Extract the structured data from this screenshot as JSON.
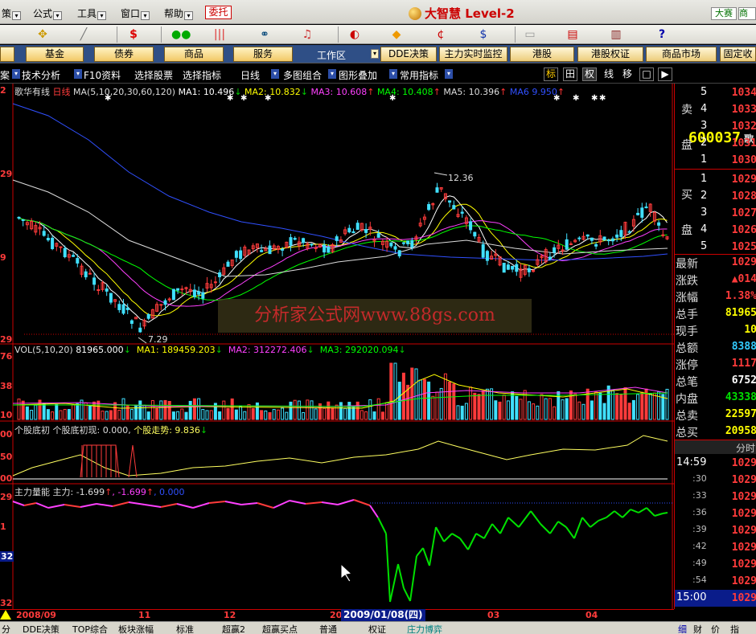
{
  "menu": [
    "策",
    "公式",
    "工具",
    "窗口",
    "帮助"
  ],
  "trust_button": "委托",
  "app_title": "大智慧 Level-2",
  "top_right_buttons": [
    "大赛",
    "商"
  ],
  "toolbar_icons": [
    "pointer-icon",
    "ruler-icon",
    "s-logo-icon",
    "traffic-icon",
    "bars-icon",
    "binoculars-icon",
    "bell-icon",
    "info-icon",
    "diamond-icon",
    "currency-icon",
    "dollar-icon",
    "folder-icon",
    "window-icon",
    "books-icon",
    "help-icon"
  ],
  "function_buttons": {
    "left": [
      "",
      "基金",
      "债券",
      "商品",
      "服务"
    ],
    "workarea": "工作区",
    "right": [
      "DDE决策",
      "主力实时监控",
      "港股",
      "港股权证",
      "商品市场",
      "固定收"
    ]
  },
  "tool_row": {
    "items": [
      "案",
      "技术分析",
      "F10资料",
      "选择股票",
      "选择指标",
      "日线",
      "多图组合",
      "图形叠加",
      "常用指标"
    ],
    "square_buttons": [
      "标",
      "田",
      "权",
      "线",
      "移",
      "□",
      "▶"
    ]
  },
  "stock_code": "600037",
  "stock_code_suffix": "歌",
  "main_chart": {
    "title": "歌华有线",
    "period": "日线",
    "ma_label": "MA(5,10,20,30,60,120)",
    "ma_values": [
      {
        "name": "MA1:",
        "value": "10.496",
        "dir": "↓",
        "color": "#ffffff"
      },
      {
        "name": "MA2:",
        "value": "10.832",
        "dir": "↓",
        "color": "#ffff00"
      },
      {
        "name": "MA3:",
        "value": "10.608",
        "dir": "↑",
        "color": "#ff40ff"
      },
      {
        "name": "MA4:",
        "value": "10.408",
        "dir": "↑",
        "color": "#00ff00"
      },
      {
        "name": "MA5:",
        "value": "10.396",
        "dir": "↑",
        "color": "#dddddd"
      },
      {
        "name": "MA6",
        "value": "9.950",
        "dir": "↑",
        "color": "#3050ff"
      }
    ],
    "high_label": "12.36",
    "low_label": "7.29",
    "y_ticks": [
      "2",
      "29",
      "9",
      "29"
    ]
  },
  "volume": {
    "label": "VOL(5,10,20)",
    "value": "81965.000",
    "ma1": "MA1: 189459.203",
    "ma2": "MA2: 312272.406",
    "ma3": "MA3: 292020.094",
    "y_ticks": [
      "76",
      "38",
      "10"
    ]
  },
  "indicator1": {
    "label": "个股底初",
    "text1": "个股底初现: 0.000,",
    "text2": "个股走势: 9.836",
    "y_ticks": [
      "00",
      "50",
      "00"
    ]
  },
  "indicator2": {
    "label": "主力量能",
    "text1": "主力: -1.699",
    "text2": ", -1.699",
    "text3": ", 0.000",
    "y_ticks": [
      "29",
      "1",
      "32",
      "32"
    ]
  },
  "watermark": "分析家公式网www.88gs.com",
  "x_axis": [
    "2008/09",
    "11",
    "12",
    "20",
    "03",
    "04"
  ],
  "crosshair_date": "2009/01/08(四)",
  "quote": {
    "sell_label": [
      "卖",
      "盘"
    ],
    "buy_label": [
      "买",
      "盘"
    ],
    "sell_levels": [
      "5",
      "4",
      "3",
      "2",
      "1"
    ],
    "sell_prices": [
      "1034",
      "1033",
      "1032",
      "1031",
      "1030"
    ],
    "buy_levels": [
      "1",
      "2",
      "3",
      "4",
      "5"
    ],
    "buy_prices": [
      "1029",
      "1028",
      "1027",
      "1026",
      "1025"
    ],
    "stats": [
      {
        "label": "最新",
        "value": "1029",
        "color": "red"
      },
      {
        "label": "涨跌",
        "value": "▲014",
        "color": "red"
      },
      {
        "label": "涨幅",
        "value": "1.38%",
        "color": "red"
      },
      {
        "label": "总手",
        "value": "81965",
        "color": "yellow"
      },
      {
        "label": "现手",
        "value": "10",
        "color": "yellow"
      },
      {
        "label": "总额",
        "value": "8388",
        "color": "cyan"
      },
      {
        "label": "涨停",
        "value": "1117",
        "color": "red"
      },
      {
        "label": "总笔",
        "value": "6752",
        "color": "white"
      },
      {
        "label": "内盘",
        "value": "43338",
        "color": "green"
      },
      {
        "label": "总卖",
        "value": "22597",
        "color": "yellow"
      },
      {
        "label": "总买",
        "value": "20958",
        "color": "yellow"
      }
    ],
    "ticks_header": "分时",
    "ticks": [
      {
        "time": "14:59",
        "price": "1029",
        "vol": ""
      },
      {
        "time": ":30",
        "price": "1029",
        "vol": ""
      },
      {
        "time": ":33",
        "price": "1029",
        "vol": ""
      },
      {
        "time": ":36",
        "price": "1029",
        "vol": ""
      },
      {
        "time": ":39",
        "price": "1029",
        "vol": ""
      },
      {
        "time": ":42",
        "price": "1029",
        "vol": ""
      },
      {
        "time": ":49",
        "price": "1029",
        "vol": ""
      },
      {
        "time": ":54",
        "price": "1029",
        "vol": ""
      },
      {
        "time": "15:00",
        "price": "1029",
        "vol": ""
      }
    ]
  },
  "bottom_tabs": [
    "分",
    "DDE决策",
    "TOP综合",
    "板块涨幅",
    "标准",
    "超赢2",
    "超赢买点",
    "普通",
    "权证",
    "庄力博弈"
  ],
  "bottom_right_tabs": [
    "细",
    "财",
    "价",
    "指"
  ]
}
